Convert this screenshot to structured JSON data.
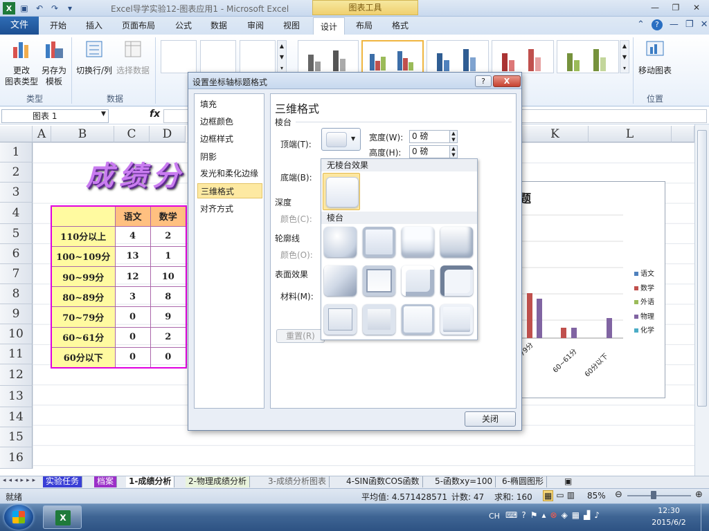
{
  "window": {
    "title": "Excel导学实验12-图表应用1 - Microsoft Excel",
    "context_tab": "图表工具"
  },
  "ribbon": {
    "file_tab": "文件",
    "tabs": [
      "开始",
      "插入",
      "页面布局",
      "公式",
      "数据",
      "审阅",
      "视图",
      "设计",
      "布局",
      "格式"
    ],
    "active_tab": "设计",
    "groups": {
      "type": {
        "label": "类型",
        "change_type_line1": "更改",
        "change_type_line2": "图表类型",
        "save_template_line1": "另存为",
        "save_template_line2": "模板"
      },
      "data": {
        "label": "数据",
        "switch_rowcol": "切换行/列",
        "select_data": "选择数据"
      },
      "location": {
        "label": "位置",
        "move_chart": "移动图表"
      }
    }
  },
  "formula_bar": {
    "name_box": "图表 1",
    "fx": "fx"
  },
  "sheet": {
    "columns": [
      "A",
      "B",
      "C",
      "D",
      "K",
      "L"
    ],
    "rows": [
      "1",
      "2",
      "3",
      "4",
      "5",
      "6",
      "7",
      "8",
      "9",
      "10",
      "11",
      "12",
      "13",
      "14",
      "15",
      "16"
    ],
    "title_fragment": "成绩分",
    "table": {
      "headers": [
        "语文",
        "数学"
      ],
      "rows": [
        {
          "label": "110分以上",
          "v1": "4",
          "v2": "2"
        },
        {
          "label": "100~109分",
          "v1": "13",
          "v2": "1"
        },
        {
          "label": "90~99分",
          "v1": "12",
          "v2": "10"
        },
        {
          "label": "80~89分",
          "v1": "3",
          "v2": "8"
        },
        {
          "label": "70~79分",
          "v1": "0",
          "v2": "9"
        },
        {
          "label": "60~61分",
          "v1": "0",
          "v2": "2"
        },
        {
          "label": "60分以下",
          "v1": "0",
          "v2": "0"
        }
      ]
    }
  },
  "chart": {
    "title_fragment": "题",
    "legend": [
      "语文",
      "数学",
      "外语",
      "物理",
      "化学"
    ],
    "legend_colors": [
      "#4f81bd",
      "#c0504d",
      "#9bbb59",
      "#8064a2",
      "#4bacc6"
    ],
    "x_labels": [
      "79分",
      "60~61分",
      "60分以下"
    ]
  },
  "dialog": {
    "title": "设置坐标轴标题格式",
    "help": "?",
    "close_x": "X",
    "nav": [
      "填充",
      "边框颜色",
      "边框样式",
      "阴影",
      "发光和柔化边缘",
      "三维格式",
      "对齐方式"
    ],
    "selected_nav": "三维格式",
    "heading": "三维格式",
    "bevel_section": "棱台",
    "top_label": "顶端(T):",
    "bottom_label": "底端(B):",
    "width_label": "宽度(W):",
    "height_label": "高度(H):",
    "width_value": "0 磅",
    "height_value": "0 磅",
    "depth_section": "深度",
    "depth_color": "颜色(C):",
    "contour_section": "轮廓线",
    "contour_color": "颜色(O):",
    "surface_section": "表面效果",
    "material_label": "材料(M):",
    "reset_button": "重置(R)",
    "close_button": "关闭",
    "gallery": {
      "no_bevel": "无棱台效果",
      "bevel": "棱台"
    }
  },
  "sheet_tabs": [
    "实验任务",
    "档案",
    "1-成绩分析",
    "2-物理成绩分析",
    "3-成绩分析图表",
    "4-SIN函数COS函数",
    "5-函数xy=100",
    "6-椭圆图形"
  ],
  "status": {
    "ready": "就绪",
    "average": "平均值: 4.571428571",
    "count": "计数: 47",
    "sum": "求和: 160",
    "zoom": "85%"
  },
  "taskbar": {
    "lang": "CH",
    "time": "12:30",
    "date": "2015/6/2"
  }
}
